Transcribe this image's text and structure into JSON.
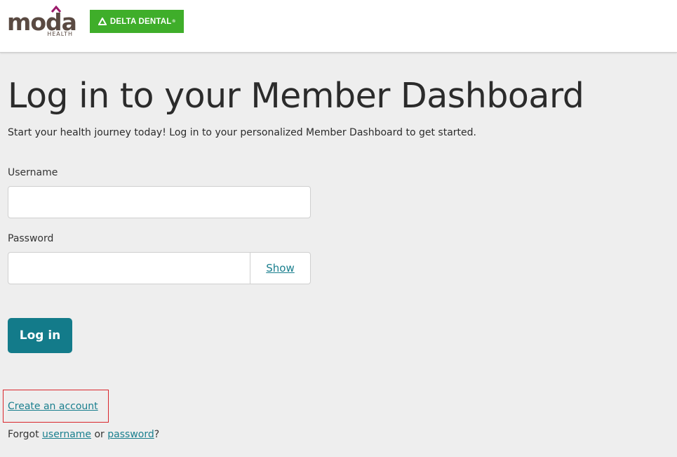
{
  "header": {
    "moda_logo_text": "moda",
    "moda_logo_sub": "HEALTH",
    "delta_logo_text": "DELTA DENTAL",
    "delta_trademark": "®"
  },
  "main": {
    "title": "Log in to your Member Dashboard",
    "subtitle": "Start your health journey today! Log in to your personalized Member Dashboard to get started.",
    "username_label": "Username",
    "username_value": "",
    "password_label": "Password",
    "password_value": "",
    "show_label": "Show",
    "login_label": "Log in",
    "create_account_label": "Create an account",
    "forgot_prefix": "Forgot ",
    "forgot_username": "username",
    "forgot_or": " or ",
    "forgot_password": "password",
    "forgot_suffix": "?"
  },
  "colors": {
    "accent": "#137b8a",
    "link": "#1a7f8e",
    "delta_green": "#3fae2a",
    "moda_brown": "#5a4a42",
    "moda_magenta": "#9b1a6b",
    "highlight_red": "#d9262c",
    "background": "#eeeeee"
  },
  "icons": {
    "moda_roof": "house-roof-icon",
    "delta": "delta-triangle-icon"
  }
}
